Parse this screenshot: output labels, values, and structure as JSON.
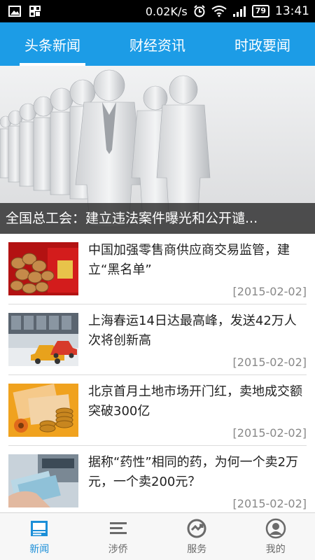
{
  "status_bar": {
    "speed": "0.02K/s",
    "battery": "79",
    "time": "13:41"
  },
  "tabs": [
    {
      "label": "头条新闻",
      "active": true
    },
    {
      "label": "财经资讯",
      "active": false
    },
    {
      "label": "时政要闻",
      "active": false
    }
  ],
  "hero": {
    "caption": "全国总工会：建立违法案件曝光和公开谴..."
  },
  "news": [
    {
      "title": "中国加强零售商供应商交易监管，建立“黑名单”",
      "date": "[2015-02-02]"
    },
    {
      "title": "上海春运14日达最高峰，发送42万人次将创新高",
      "date": "[2015-02-02]"
    },
    {
      "title": "北京首月土地市场开门红，卖地成交额突破300亿",
      "date": "[2015-02-02]"
    },
    {
      "title": "据称“药性”相同的药，为何一个卖2万元，一个卖200元？",
      "date": "[2015-02-02]"
    }
  ],
  "bottom_nav": [
    {
      "label": "新闻",
      "icon": "newspaper-icon",
      "active": true
    },
    {
      "label": "涉侨",
      "icon": "list-icon",
      "active": false
    },
    {
      "label": "服务",
      "icon": "service-icon",
      "active": false
    },
    {
      "label": "我的",
      "icon": "profile-icon",
      "active": false
    }
  ],
  "colors": {
    "accent": "#1c9ce6",
    "nav_active": "#1c8fd8"
  }
}
